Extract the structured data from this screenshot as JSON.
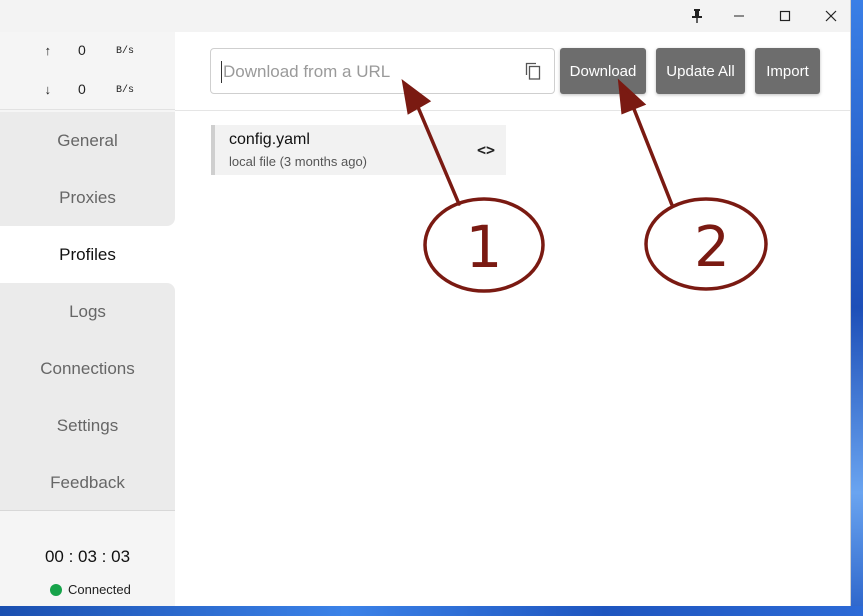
{
  "window": {
    "pin_icon": "pin-icon",
    "minimize_icon": "minimize-icon",
    "maximize_icon": "maximize-icon",
    "close_icon": "close-icon"
  },
  "traffic": {
    "up_arrow": "↑",
    "up_value": "0",
    "up_unit": "B/s",
    "down_arrow": "↓",
    "down_value": "0",
    "down_unit": "B/s"
  },
  "nav": {
    "items": [
      {
        "label": "General"
      },
      {
        "label": "Proxies"
      },
      {
        "label": "Profiles",
        "active": true
      },
      {
        "label": "Logs"
      },
      {
        "label": "Connections"
      },
      {
        "label": "Settings"
      },
      {
        "label": "Feedback"
      }
    ]
  },
  "footer": {
    "timer": "00 : 03 : 03",
    "status": "Connected",
    "status_color": "#16a34a"
  },
  "toolbar": {
    "url_placeholder": "Download from a URL",
    "url_value": "",
    "copy_icon": "copy-icon",
    "download_label": "Download",
    "update_all_label": "Update All",
    "import_label": "Import",
    "button_color": "#6d6d6d"
  },
  "profiles": [
    {
      "name": "config.yaml",
      "meta": "local file (3 months ago)",
      "icon": "code-icon"
    }
  ],
  "annotations": {
    "marker_1": "1",
    "marker_2": "2",
    "color": "#7a1a12"
  }
}
